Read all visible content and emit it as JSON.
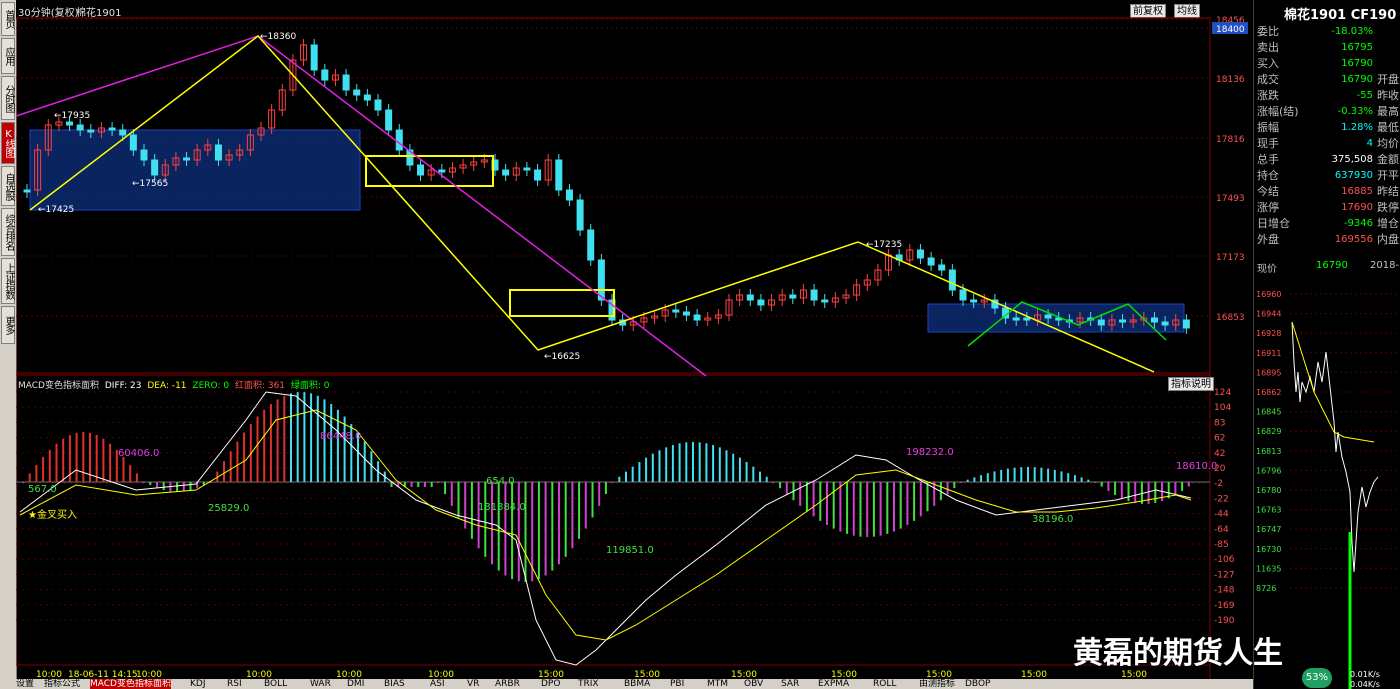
{
  "sidebar": {
    "items": [
      {
        "label": "首页",
        "active": false
      },
      {
        "label": "应用",
        "active": false
      },
      {
        "label": "分时图",
        "active": false
      },
      {
        "label": "K线图",
        "active": true
      },
      {
        "label": "自选股",
        "active": false
      },
      {
        "label": "综合排名",
        "active": false
      },
      {
        "label": "上证指数",
        "active": false
      },
      {
        "label": "更多",
        "active": false
      }
    ]
  },
  "header": {
    "period": "30分钟(复权)",
    "contract": "棉花1901",
    "btn_prev_fq": "前复权",
    "btn_avg": "均线"
  },
  "main_chart": {
    "price_axis": [
      "18456",
      "18400",
      "18136",
      "17816",
      "17493",
      "17173",
      "16853"
    ],
    "labels": {
      "high": "18360",
      "l1": "17935",
      "l2": "17565",
      "l3": "17425",
      "l4": "16625",
      "l5": "17235"
    }
  },
  "macd": {
    "title": "MACD变色指标面积",
    "diff": "DIFF: 23",
    "dea": "DEA: -11",
    "zero": "ZERO: 0",
    "red_area": "红面积: 361",
    "green_area": "绿面积: 0",
    "btn_explain": "指标说明",
    "axis": [
      "124",
      "104",
      "83",
      "62",
      "42",
      "20",
      "-2",
      "-22",
      "-44",
      "-64",
      "-85",
      "-106",
      "-127",
      "-148",
      "-169",
      "-190"
    ],
    "area_labels": [
      "60406.0",
      "86448.0",
      "567.0",
      "25829.0",
      "654.0",
      "131384.0",
      "119851.0",
      "198232.0",
      "18610.0",
      "38196.0"
    ],
    "signal": "金叉买入"
  },
  "time_axis": [
    "10:00",
    "18-06-11 14:15",
    "10:00",
    "10:00",
    "10:00",
    "10:00",
    "15:00",
    "15:00",
    "15:00",
    "15:00",
    "15:00",
    "15:00",
    "15:00"
  ],
  "quote": {
    "title": "棉花1901 CF190",
    "rows": [
      {
        "l": "委比",
        "v": "-18.03%",
        "c": "#00ff00",
        "r": ""
      },
      {
        "l": "卖出",
        "v": "16795",
        "c": "#00ff00",
        "r": ""
      },
      {
        "l": "买入",
        "v": "16790",
        "c": "#00ff00",
        "r": ""
      },
      {
        "l": "成交",
        "v": "16790",
        "c": "#00ff00",
        "r": "开盘"
      },
      {
        "l": "涨跌",
        "v": "-55",
        "c": "#00ff00",
        "r": "昨收"
      },
      {
        "l": "涨幅(结)",
        "v": "-0.33%",
        "c": "#00ff00",
        "r": "最高"
      },
      {
        "l": "振幅",
        "v": "1.28%",
        "c": "#00ffff",
        "r": "最低"
      },
      {
        "l": "现手",
        "v": "4",
        "c": "#00ffff",
        "r": "均价"
      },
      {
        "l": "总手",
        "v": "375,508",
        "c": "#ffffff",
        "r": "金额"
      },
      {
        "l": "持仓",
        "v": "637930",
        "c": "#00ffff",
        "r": "开平"
      },
      {
        "l": "今结",
        "v": "16885",
        "c": "#ff5050",
        "r": "昨结"
      },
      {
        "l": "涨停",
        "v": "17690",
        "c": "#ff5050",
        "r": "跌停"
      },
      {
        "l": "日增仓",
        "v": "-9346",
        "c": "#00ff00",
        "r": "增仓"
      },
      {
        "l": "外盘",
        "v": "169556",
        "c": "#ff5050",
        "r": "内盘"
      }
    ],
    "now_label": "现价",
    "now_value": "16790",
    "now_date": "2018-",
    "mini_axis": [
      "16960",
      "16944",
      "16928",
      "16911",
      "16895",
      "16862",
      "16845",
      "16829",
      "16813",
      "16796",
      "16780",
      "16763",
      "16747",
      "16730",
      "11635",
      "8726"
    ],
    "gauge": "53%",
    "speed_up": "0.01K/s",
    "speed_down": "0.04K/s"
  },
  "bottom_tabs": [
    "设置",
    "指标公式",
    "MACD变色指标面积",
    "KDJ",
    "RSI",
    "BOLL",
    "WAR",
    "DMI",
    "BIAS",
    "ASI",
    "VR",
    "ARBR",
    "DPO",
    "TRIX",
    "BBMA",
    "PBI",
    "MTM",
    "OBV",
    "SAR",
    "EXPMA",
    "ROLL",
    "由测指标",
    "DBOP"
  ],
  "watermark": "黄磊的期货人生"
}
